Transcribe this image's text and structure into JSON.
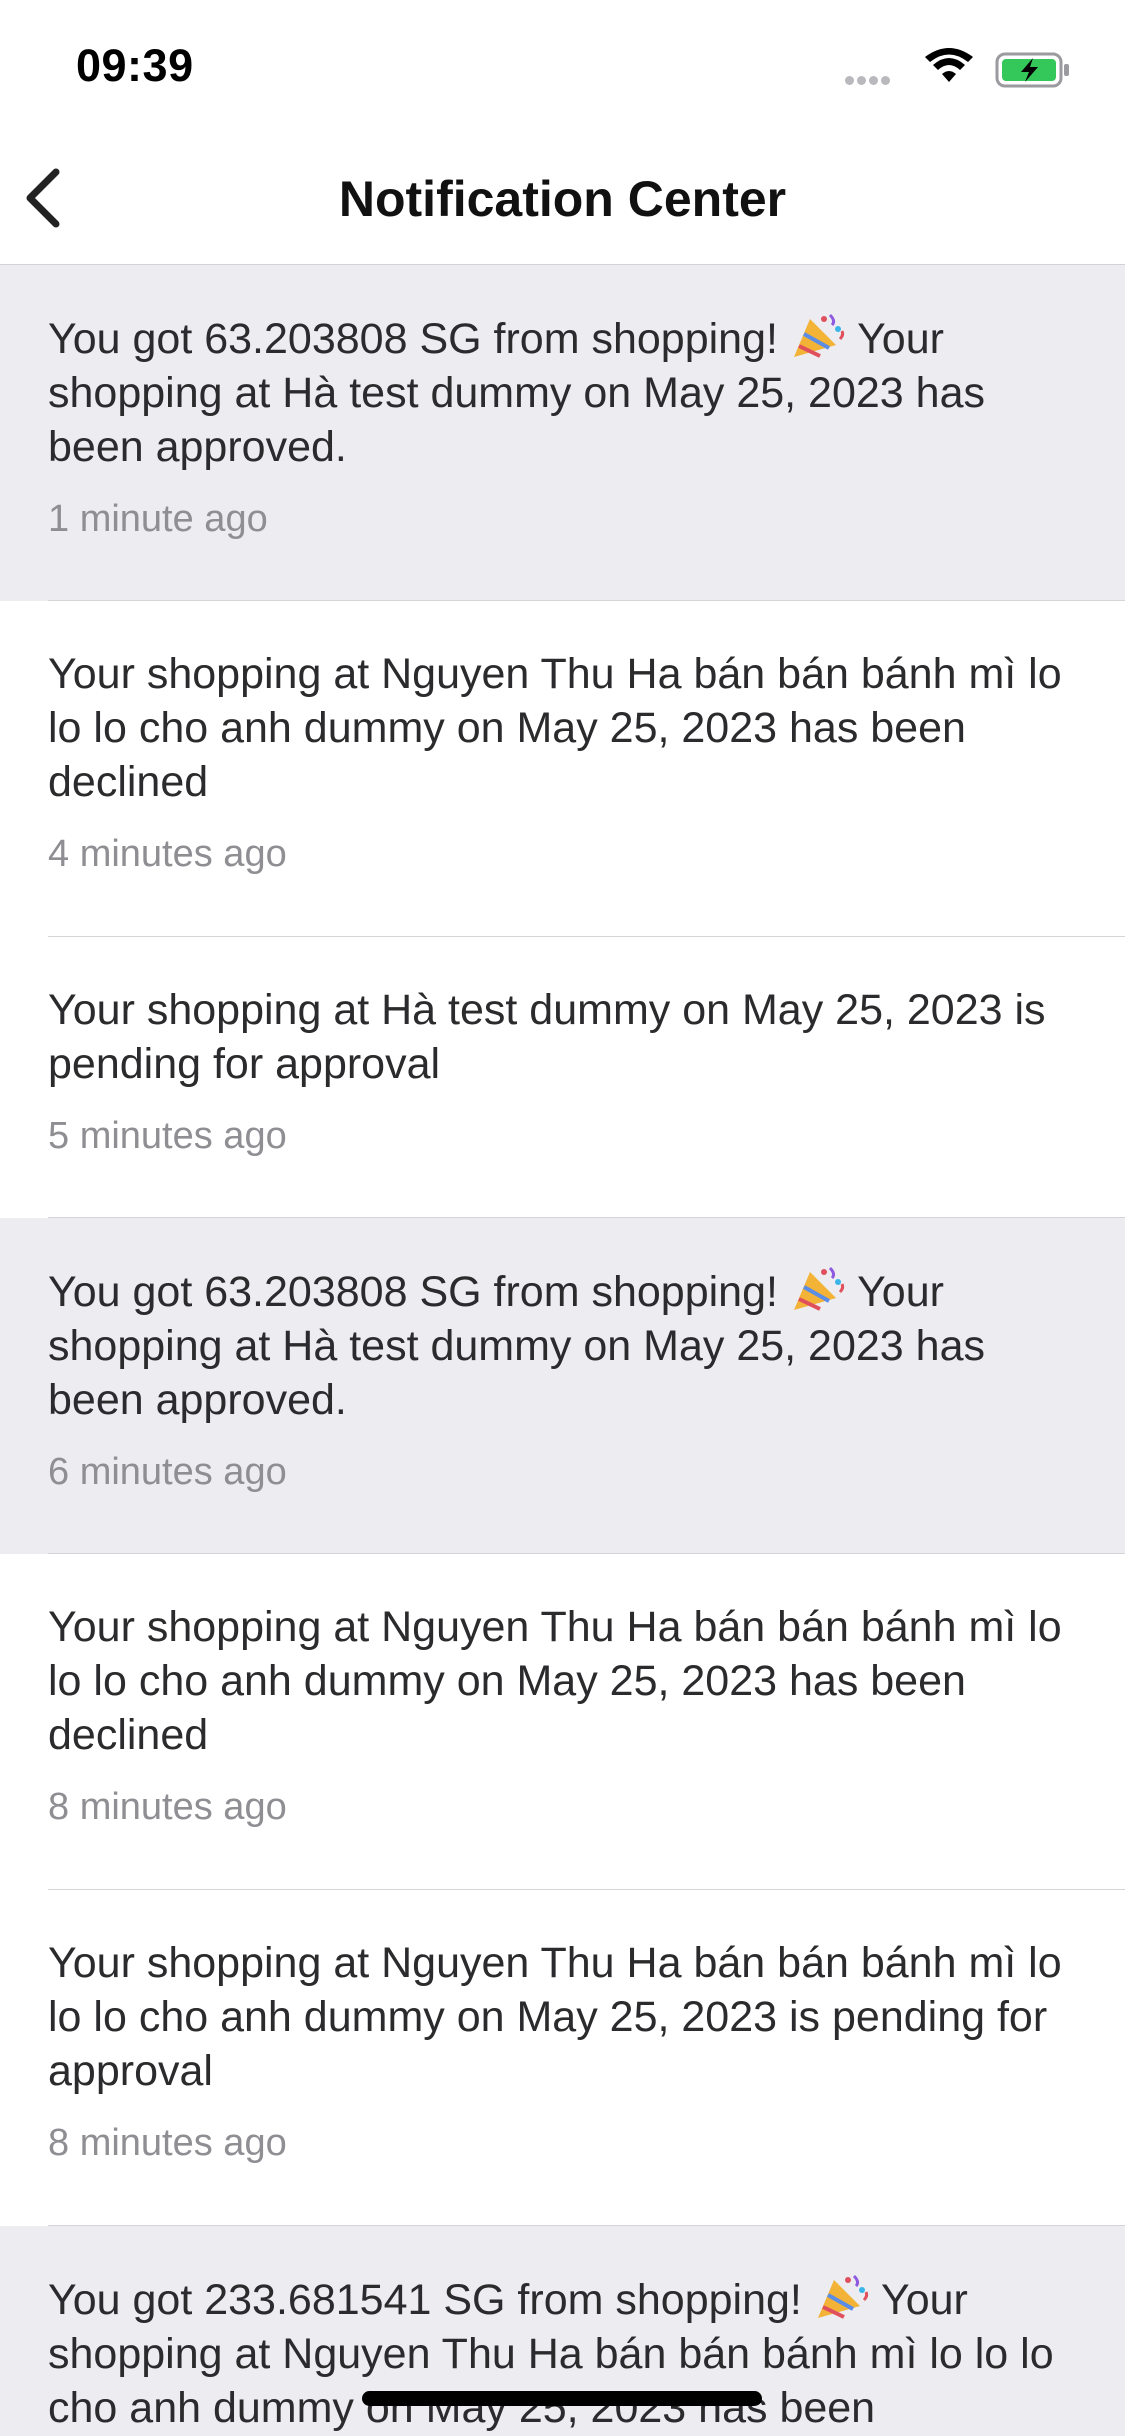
{
  "status_bar": {
    "time": "09:39"
  },
  "header": {
    "title": "Notification Center",
    "back_icon": "chevron-left-icon"
  },
  "notifications": [
    {
      "pre": "You got 63.203808 SG from shopping! ",
      "emoji": "party-popper-icon",
      "post": " Your shopping at Hà test dummy on May 25, 2023 has been approved.",
      "time": "1 minute ago",
      "unread": true
    },
    {
      "pre": "Your shopping at Nguyen Thu Ha bán bán bánh mì lo lo lo cho anh dummy on May 25, 2023 has been declined",
      "emoji": "",
      "post": "",
      "time": "4 minutes ago",
      "unread": false
    },
    {
      "pre": "Your shopping at Hà test dummy on May 25, 2023 is pending for approval",
      "emoji": "",
      "post": "",
      "time": "5 minutes ago",
      "unread": false
    },
    {
      "pre": "You got 63.203808 SG from shopping! ",
      "emoji": "party-popper-icon",
      "post": " Your shopping at Hà test dummy on May 25, 2023 has been approved.",
      "time": "6 minutes ago",
      "unread": true
    },
    {
      "pre": "Your shopping at Nguyen Thu Ha bán bán bánh mì lo lo lo cho anh dummy on May 25, 2023 has been declined",
      "emoji": "",
      "post": "",
      "time": "8 minutes ago",
      "unread": false
    },
    {
      "pre": "Your shopping at Nguyen Thu Ha bán bán bánh mì lo lo lo cho anh dummy on May 25, 2023 is pending for approval",
      "emoji": "",
      "post": "",
      "time": "8 minutes ago",
      "unread": false
    },
    {
      "pre": "You got 233.681541 SG from shopping! ",
      "emoji": "party-popper-icon",
      "post": " Your shopping at Nguyen Thu Ha bán bán bánh mì lo lo lo cho anh dummy on May 25, 2023 has been",
      "time": "",
      "unread": true
    }
  ],
  "colors": {
    "unread_background": "#ececf1",
    "read_background": "#ffffff",
    "timestamp": "#8e8e93",
    "battery_fill": "#34c759"
  }
}
